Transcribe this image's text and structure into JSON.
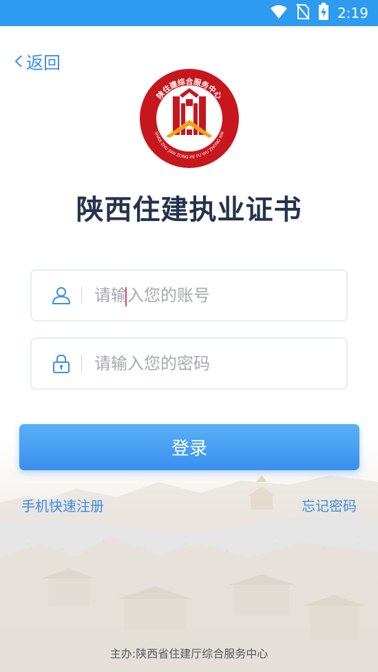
{
  "status_bar": {
    "time": "2:19",
    "icons": [
      "wifi-icon",
      "no-sim-icon",
      "battery-charging-icon"
    ],
    "background": "#2d9bf0"
  },
  "header": {
    "back_label": "返回"
  },
  "logo": {
    "ring_text": "陕住建综合服务中心",
    "pinyin": "SHAN ZHU JIAN ZONG HE FU WU ZHONG XIN",
    "color": "#c8161d",
    "roof_color": "#f4a21a"
  },
  "title": "陕西住建执业证书",
  "form": {
    "account_placeholder": "请输入您的账号",
    "password_placeholder": "请输入您的密码",
    "login_label": "登录"
  },
  "links": {
    "register": "手机快速注册",
    "forgot_password": "忘记密码"
  },
  "footer": "主办:陕西省住建厅综合服务中心",
  "colors": {
    "accent": "#3a8fe8",
    "title": "#24334d",
    "placeholder": "#a3a9b1"
  }
}
